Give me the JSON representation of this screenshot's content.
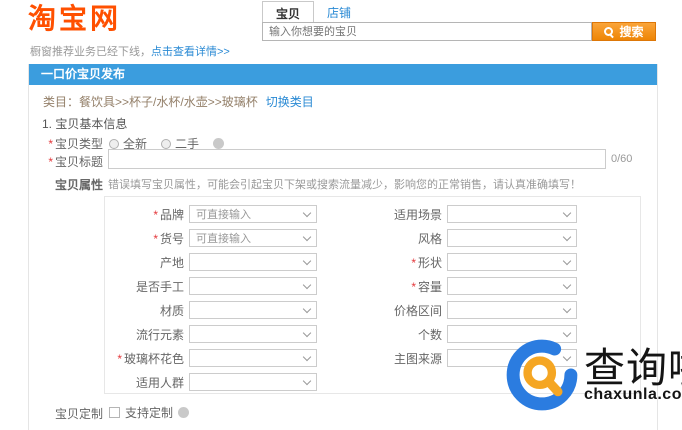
{
  "header": {
    "logo_text": "淘宝网",
    "tabs": [
      {
        "label": "宝贝",
        "active": true
      },
      {
        "label": "店铺",
        "active": false
      }
    ],
    "search": {
      "placeholder": "输入你想要的宝贝",
      "button_label": "搜索"
    },
    "notice": {
      "text": "橱窗推荐业务已经下线，",
      "link": "点击查看详情>>"
    }
  },
  "panel": {
    "title": "一口价宝贝发布",
    "category": {
      "label": "类目：",
      "path": "餐饮具>>杯子/水杯/水壶>>玻璃杯",
      "switch_link": "切换类目"
    },
    "section_title": "1. 宝贝基本信息",
    "type_field": {
      "label": "宝贝类型",
      "required": true,
      "options": [
        "全新",
        "二手"
      ]
    },
    "title_field": {
      "label": "宝贝标题",
      "required": true,
      "value": "",
      "counter": "0/60"
    },
    "attrs": {
      "label": "宝贝属性",
      "hint": "错误填写宝贝属性，可能会引起宝贝下架或搜索流量减少，影响您的正常销售，请认真准确填写！",
      "rows": [
        {
          "left": {
            "label": "品牌",
            "required": true,
            "value": "可直接输入"
          },
          "right": {
            "label": "适用场景",
            "required": false,
            "value": ""
          }
        },
        {
          "left": {
            "label": "货号",
            "required": true,
            "value": "可直接输入"
          },
          "right": {
            "label": "风格",
            "required": false,
            "value": ""
          }
        },
        {
          "left": {
            "label": "产地",
            "required": false,
            "value": ""
          },
          "right": {
            "label": "形状",
            "required": true,
            "value": ""
          }
        },
        {
          "left": {
            "label": "是否手工",
            "required": false,
            "value": ""
          },
          "right": {
            "label": "容量",
            "required": true,
            "value": ""
          }
        },
        {
          "left": {
            "label": "材质",
            "required": false,
            "value": ""
          },
          "right": {
            "label": "价格区间",
            "required": false,
            "value": ""
          }
        },
        {
          "left": {
            "label": "流行元素",
            "required": false,
            "value": ""
          },
          "right": {
            "label": "个数",
            "required": false,
            "value": ""
          }
        },
        {
          "left": {
            "label": "玻璃杯花色",
            "required": true,
            "value": ""
          },
          "right": {
            "label": "主图来源",
            "required": false,
            "value": ""
          }
        },
        {
          "left": {
            "label": "适用人群",
            "required": false,
            "value": ""
          },
          "right": null
        }
      ]
    },
    "custom_field": {
      "label": "宝贝定制",
      "checkbox_label": "支持定制",
      "checked": false
    }
  },
  "watermark": {
    "title": "查询啦",
    "domain": "chaxunla.com"
  },
  "colors": {
    "brand_orange": "#ff5000",
    "button_orange": "#ee8505",
    "panel_blue": "#3b9dde",
    "link_blue": "#2a8ad4",
    "required_red": "#e4393c",
    "category_brown": "#94806a",
    "watermark_blue": "#2b7ce0",
    "watermark_orange": "#f5a623"
  }
}
